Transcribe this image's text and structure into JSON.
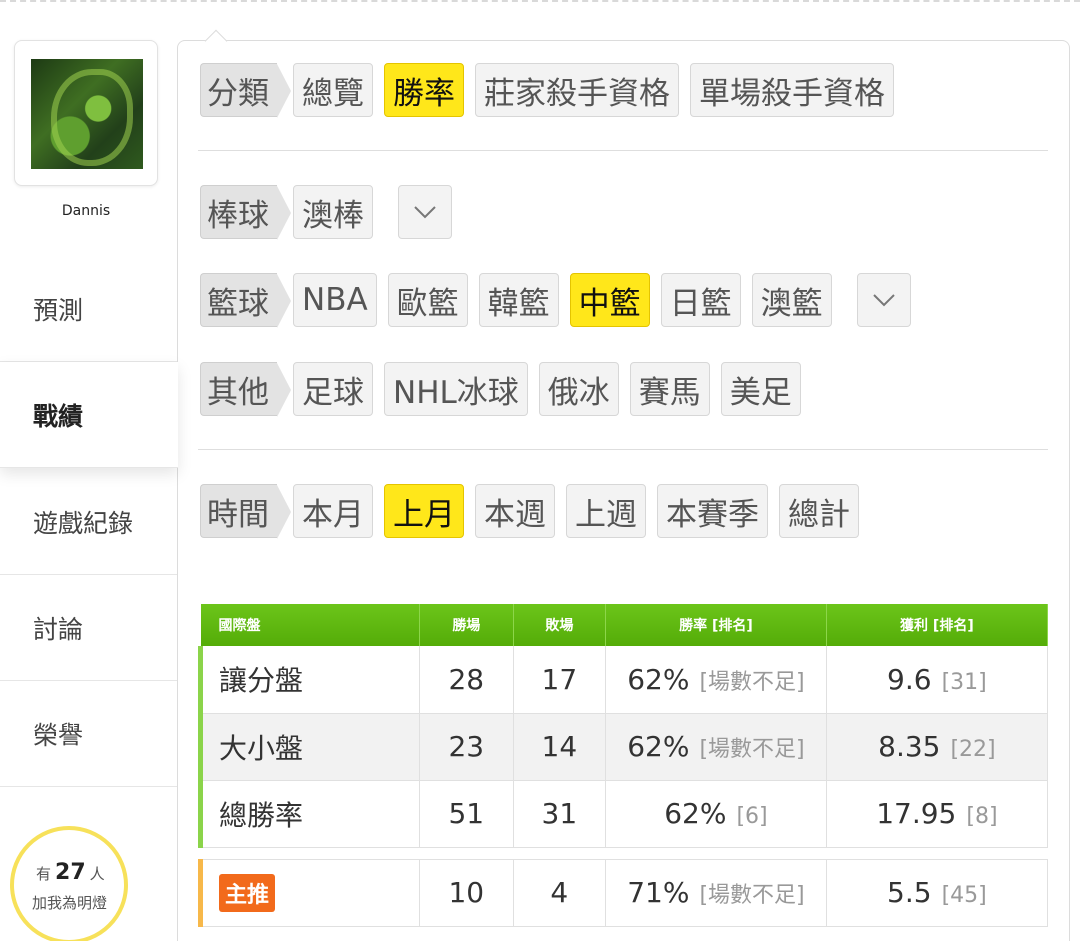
{
  "profile": {
    "name": "Dannis"
  },
  "nav": [
    {
      "label": "預測"
    },
    {
      "label": "戰績"
    },
    {
      "label": "遊戲紀錄"
    },
    {
      "label": "討論"
    },
    {
      "label": "榮譽"
    }
  ],
  "fans": {
    "prefix": "有",
    "count": "27",
    "suffix": "人",
    "line2": "加我為明燈"
  },
  "filters": {
    "category": {
      "header": "分類",
      "options": [
        "總覽",
        "勝率",
        "莊家殺手資格",
        "單場殺手資格"
      ],
      "selected": "勝率"
    },
    "baseball": {
      "header": "棒球",
      "options": [
        "澳棒"
      ]
    },
    "basketball": {
      "header": "籃球",
      "options": [
        "NBA",
        "歐籃",
        "韓籃",
        "中籃",
        "日籃",
        "澳籃"
      ],
      "selected": "中籃"
    },
    "other": {
      "header": "其他",
      "options": [
        "足球",
        "NHL冰球",
        "俄冰",
        "賽馬",
        "美足"
      ]
    },
    "time": {
      "header": "時間",
      "options": [
        "本月",
        "上月",
        "本週",
        "上週",
        "本賽季",
        "總計"
      ],
      "selected": "上月"
    }
  },
  "table": {
    "headers": [
      "國際盤",
      "勝場",
      "敗場",
      "勝率 [排名]",
      "獲利 [排名]"
    ],
    "rows": [
      {
        "name": "讓分盤",
        "win": "28",
        "loss": "17",
        "rate": "62%",
        "rate_rank": "[場數不足]",
        "profit": "9.6",
        "profit_rank": "[31]"
      },
      {
        "name": "大小盤",
        "win": "23",
        "loss": "14",
        "rate": "62%",
        "rate_rank": "[場數不足]",
        "profit": "8.35",
        "profit_rank": "[22]"
      },
      {
        "name": "總勝率",
        "win": "51",
        "loss": "31",
        "rate": "62%",
        "rate_rank": "[6]",
        "profit": "17.95",
        "profit_rank": "[8]"
      }
    ],
    "featured": {
      "badge": "主推",
      "win": "10",
      "loss": "4",
      "rate": "71%",
      "rate_rank": "[場數不足]",
      "profit": "5.5",
      "profit_rank": "[45]"
    }
  },
  "colors": {
    "selected": "#ffe71a",
    "table_header": "#5cb810",
    "badge": "#f26a1b",
    "fans_ring": "#f7e15a"
  }
}
